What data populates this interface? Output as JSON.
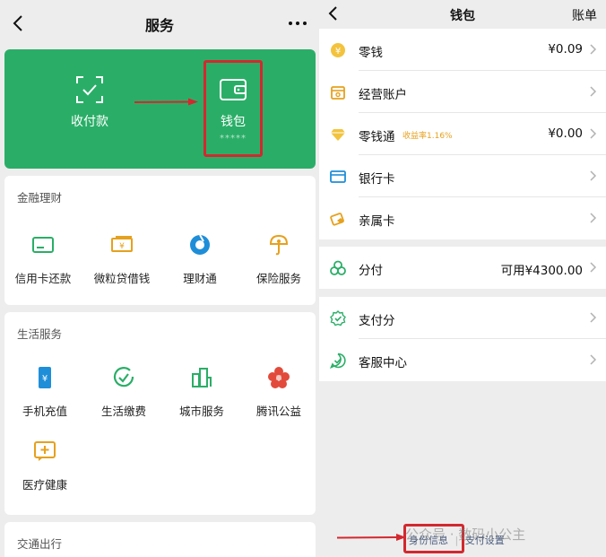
{
  "left": {
    "nav": {
      "title": "服务"
    },
    "card": {
      "pay": "收付款",
      "wallet": "钱包",
      "wallet_hidden": "*****"
    },
    "finance": {
      "title": "金融理财",
      "items": [
        {
          "label": "信用卡还款",
          "icon": "credit-card-icon"
        },
        {
          "label": "微粒贷借钱",
          "icon": "loan-icon"
        },
        {
          "label": "理财通",
          "icon": "wealth-icon"
        },
        {
          "label": "保险服务",
          "icon": "insurance-icon"
        }
      ]
    },
    "life": {
      "title": "生活服务",
      "items": [
        {
          "label": "手机充值",
          "icon": "phone-topup-icon"
        },
        {
          "label": "生活缴费",
          "icon": "utility-payment-icon"
        },
        {
          "label": "城市服务",
          "icon": "city-service-icon"
        },
        {
          "label": "腾讯公益",
          "icon": "charity-icon"
        },
        {
          "label": "医疗健康",
          "icon": "medical-icon"
        }
      ]
    },
    "transport": {
      "title": "交通出行"
    }
  },
  "right": {
    "nav": {
      "title": "钱包",
      "bill": "账单"
    },
    "rows": [
      {
        "label": "零钱",
        "value": "¥0.09",
        "icon": "change-coin-icon"
      },
      {
        "label": "经营账户",
        "value": "",
        "icon": "business-account-icon"
      },
      {
        "label": "零钱通",
        "sub": "收益率1.16%",
        "value": "¥0.00",
        "icon": "diamond-icon"
      },
      {
        "label": "银行卡",
        "value": "",
        "icon": "bank-card-icon"
      },
      {
        "label": "亲属卡",
        "value": "",
        "icon": "family-card-icon"
      },
      {
        "label": "分付",
        "value": "可用¥4300.00",
        "icon": "credit-pay-icon"
      },
      {
        "label": "支付分",
        "value": "",
        "icon": "pay-score-icon"
      },
      {
        "label": "客服中心",
        "value": "",
        "icon": "customer-service-icon"
      }
    ],
    "footer": {
      "identity": "身份信息",
      "separator": "|",
      "settings": "支付设置"
    }
  },
  "watermark": "公众号 · 数码小公主",
  "colors": {
    "green": "#2aae67",
    "highlight": "#d3282f",
    "link": "#4a5d80",
    "accent": "#e6a11d"
  }
}
